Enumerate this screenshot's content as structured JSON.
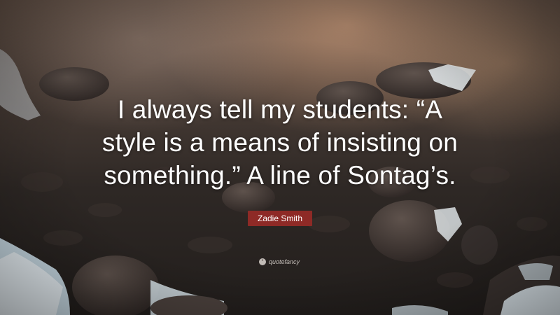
{
  "quote": {
    "line1": "I always tell my students: “A",
    "line2": "style is a means of insisting on",
    "line3": "something.” A line of Sontag’s."
  },
  "author": "Zadie Smith",
  "brand": {
    "logo": "“",
    "name": "quotefancy"
  }
}
